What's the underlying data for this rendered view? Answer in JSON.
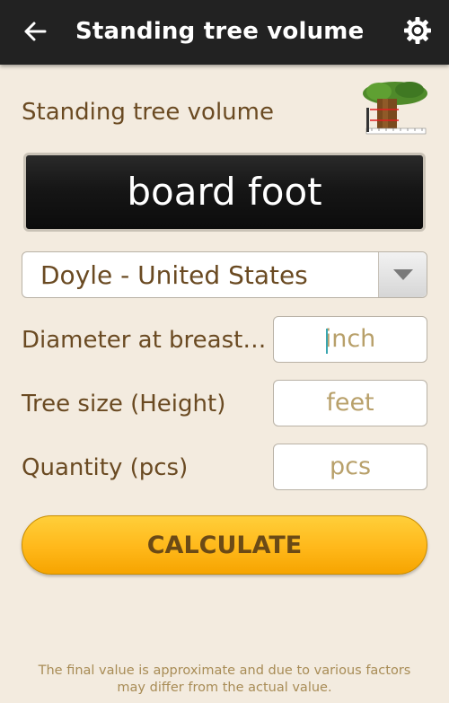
{
  "appbar": {
    "title": "Standing tree volume",
    "back_icon": "arrow-left-icon",
    "settings_icon": "gear-icon"
  },
  "header": {
    "title": "Standing tree volume",
    "image": "tree-measure-icon"
  },
  "unit_display": {
    "value": "board foot"
  },
  "method_select": {
    "value": "Doyle - United States"
  },
  "fields": {
    "diameter": {
      "label": "Diameter at breast…",
      "placeholder": "inch"
    },
    "height": {
      "label": "Tree size (Height)",
      "placeholder": "feet"
    },
    "quantity": {
      "label": "Quantity (pcs)",
      "placeholder": "pcs"
    }
  },
  "calculate_button": {
    "label": "CALCULATE"
  },
  "disclaimer": {
    "line1": "The final value is approximate and due to various factors",
    "line2": "may differ from the actual value."
  },
  "colors": {
    "appbar": "#222222",
    "background": "#f3ebdf",
    "text_brown": "#6a4a22",
    "placeholder": "#b8a06a",
    "button": "#ffb81a"
  }
}
